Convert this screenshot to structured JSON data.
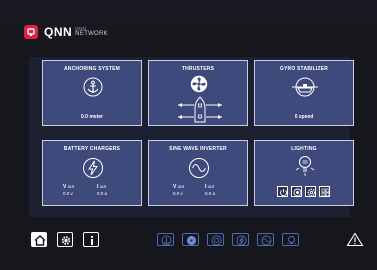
{
  "colors": {
    "accent": "#e0203c",
    "card_bg": "#3f4a7c",
    "card_border": "#c9cde0",
    "panel_bg": "#1d2030",
    "shortcut_border": "#4a6ab8"
  },
  "header": {
    "brand": "QNN",
    "sub_top": "QNN",
    "sub_bottom": "NETWORK",
    "logo_icon": "qnn-logo-icon"
  },
  "cards": {
    "anchoring": {
      "title": "ANCHORING SYSTEM",
      "value": "0.0 meter",
      "icon": "anchor-icon"
    },
    "thrusters": {
      "title": "THRUSTERS",
      "icon": "fan-icon"
    },
    "gyro": {
      "title": "GYRO STABILIZER",
      "value": "0 speed",
      "icon": "gyro-icon"
    },
    "battery": {
      "title": "BATTERY CHARGERS",
      "icon": "lightning-icon",
      "v_label": "V",
      "v_unit": "out",
      "v_value": "0.0",
      "v_suffix": "v",
      "i_label": "I",
      "i_unit": "out",
      "i_value": "0.0",
      "i_suffix": "a"
    },
    "inverter": {
      "title": "SINE WAVE INVERTER",
      "icon": "sine-wave-icon",
      "v_label": "V",
      "v_unit": "out",
      "v_value": "0.0",
      "v_suffix": "v",
      "i_label": "I",
      "i_unit": "out",
      "i_value": "0.0",
      "i_suffix": "a"
    },
    "lighting": {
      "title": "LIGHTING",
      "icon": "bulb-icon",
      "buttons": [
        "power-icon",
        "spot-icon",
        "gear-icon",
        "grid-icon"
      ]
    }
  },
  "bottom_nav": {
    "buttons": [
      "home-icon",
      "settings-icon",
      "info-icon"
    ],
    "shortcuts": [
      "anchor-icon",
      "fan-icon",
      "gyro-icon",
      "lightning-icon",
      "sine-wave-icon",
      "bulb-icon"
    ],
    "alarm_icon": "warning-icon"
  }
}
